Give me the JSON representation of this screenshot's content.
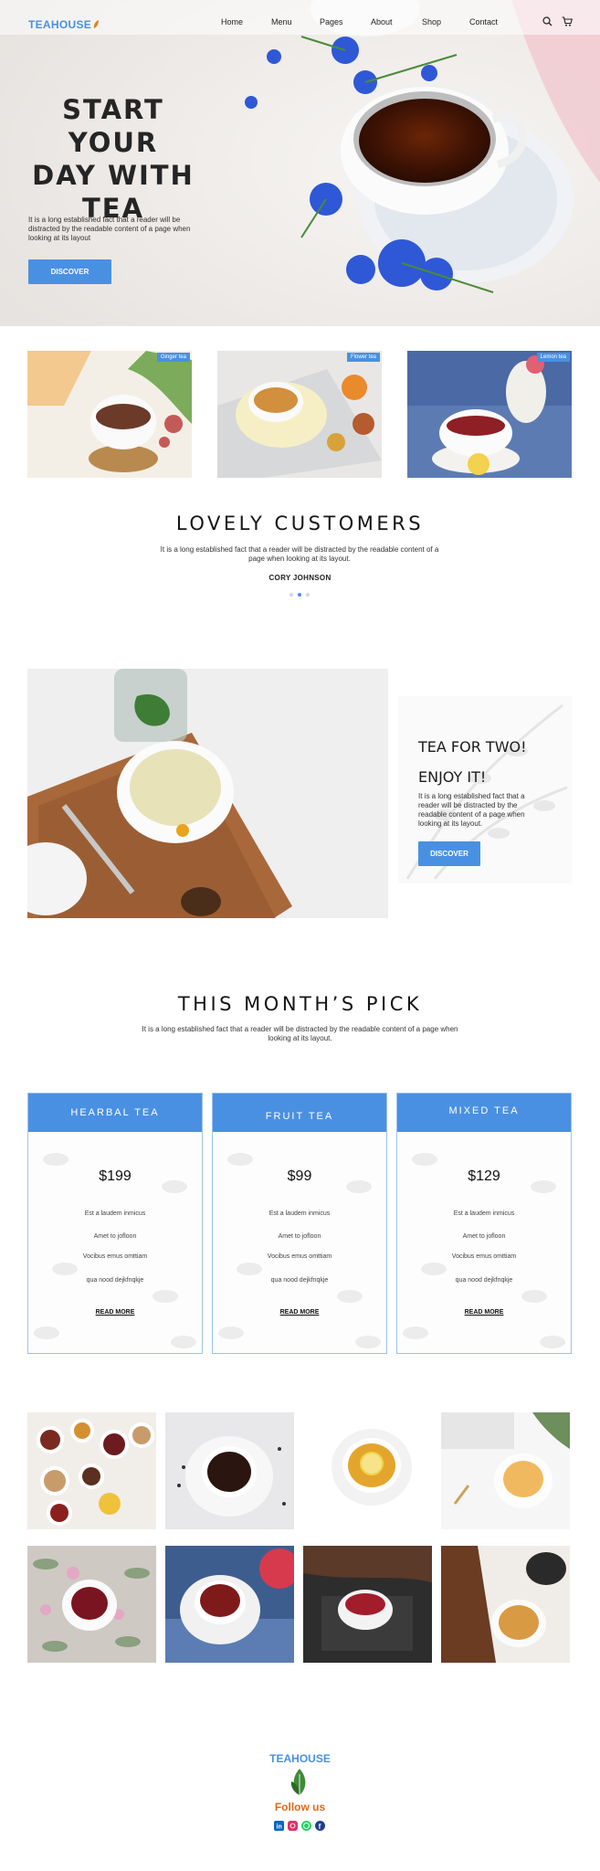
{
  "brand": {
    "name": "TEAHOUSE",
    "accent": "#4A90E2",
    "footer_orange": "#E06A1A"
  },
  "nav": {
    "links": [
      "Home",
      "Menu",
      "Pages",
      "About",
      "Shop",
      "Contact"
    ],
    "icons": [
      "search-icon",
      "cart-icon"
    ]
  },
  "hero": {
    "title_lines": [
      "START YOUR",
      "DAY WITH",
      "TEA"
    ],
    "text": "It is a long established fact that a reader will be distracted by the readable content of a page when looking at its layout",
    "button": "DISCOVER"
  },
  "categories": [
    {
      "label": "Ginger tea"
    },
    {
      "label": "Flower tea"
    },
    {
      "label": "Lemon tea"
    }
  ],
  "customers": {
    "title": "LOVELY CUSTOMERS",
    "text": "It is a long established fact that a reader will be distracted by the readable content of a page when looking at its layout.",
    "name": "CORY JOHNSON",
    "active_dot": 2
  },
  "promo": {
    "line1": "TEA FOR TWO!",
    "line2": "ENJOY IT!",
    "text": "It is a long established fact that a reader will be distracted by the readable content of a page when looking at its layout.",
    "button": "DISCOVER"
  },
  "pick": {
    "title": "THIS MONTH’S PICK",
    "text": "It is a long established fact that a reader will be distracted by the readable content of a page when looking at its layout."
  },
  "pricing": [
    {
      "name": "HEARBAL TEA",
      "price": "$199",
      "items": [
        "Est a laudem inmicus",
        "Amet to jofloon",
        "Vocibus emus omttiam",
        "qua nood dejkfnqkje"
      ],
      "more": "READ MORE"
    },
    {
      "name": "FRUIT TEA",
      "price": "$99",
      "items": [
        "Est a laudem inmicus",
        "Amet to jofloon",
        "Vocibus emus omttiam",
        "qua nood dejkfnqkje"
      ],
      "more": "READ MORE"
    },
    {
      "name": "MIXED TEA",
      "price": "$129",
      "items": [
        "Est a laudem inmicus",
        "Amet to jofloon",
        "Vocibus emus omttiam",
        "qua nood dejkfnqkje"
      ],
      "more": "READ MORE"
    }
  ],
  "footer": {
    "brand": "TEAHOUSE",
    "follow": "Follow us",
    "social": [
      "linkedin-icon",
      "instagram-icon",
      "whatsapp-icon",
      "facebook-icon"
    ]
  }
}
